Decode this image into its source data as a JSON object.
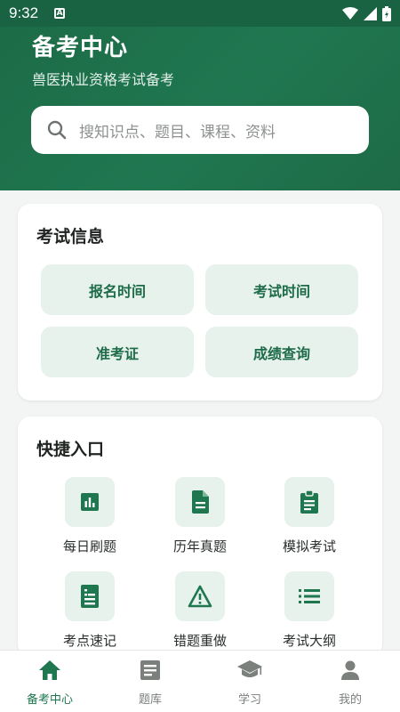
{
  "status_bar": {
    "time": "9:32",
    "notification_icon": "A"
  },
  "header": {
    "title": "备考中心",
    "subtitle": "兽医执业资格考试备考",
    "search_placeholder": "搜知识点、题目、课程、资料"
  },
  "exam_info": {
    "title": "考试信息",
    "buttons": [
      "报名时间",
      "考试时间",
      "准考证",
      "成绩查询"
    ]
  },
  "quick_entry": {
    "title": "快捷入口",
    "items": [
      {
        "label": "每日刷题",
        "icon": "bar-chart-icon"
      },
      {
        "label": "历年真题",
        "icon": "document-icon"
      },
      {
        "label": "模拟考试",
        "icon": "clipboard-icon"
      },
      {
        "label": "考点速记",
        "icon": "notes-icon"
      },
      {
        "label": "错题重做",
        "icon": "warning-icon"
      },
      {
        "label": "考试大纲",
        "icon": "list-icon"
      }
    ]
  },
  "bottom_nav": [
    {
      "label": "备考中心",
      "icon": "home-icon",
      "active": true
    },
    {
      "label": "题库",
      "icon": "question-bank-icon",
      "active": false
    },
    {
      "label": "学习",
      "icon": "graduation-cap-icon",
      "active": false
    },
    {
      "label": "我的",
      "icon": "person-icon",
      "active": false
    }
  ],
  "colors": {
    "primary": "#1f7750",
    "tint": "#e6f2eb",
    "inactive": "#7b807d"
  }
}
